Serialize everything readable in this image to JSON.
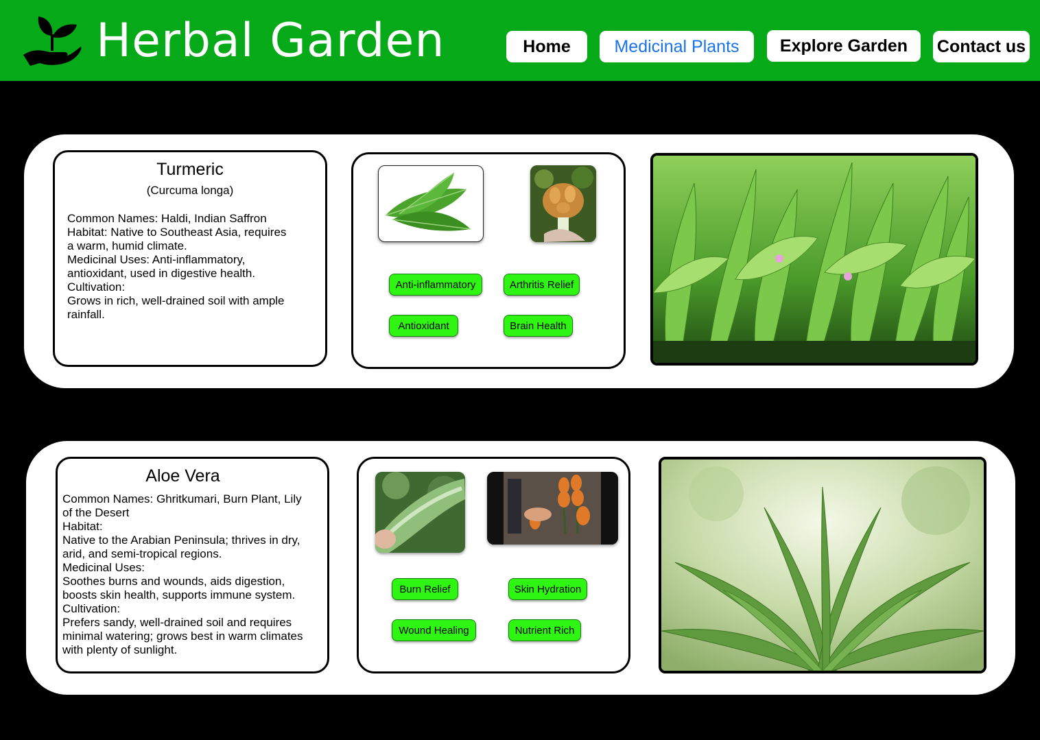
{
  "header": {
    "title": "Herbal Garden",
    "nav": {
      "home": "Home",
      "medicinal_plants": "Medicinal Plants",
      "explore_garden": "Explore Garden",
      "contact_us": "Contact us"
    },
    "logo_icon": "plant-in-hand-icon"
  },
  "colors": {
    "header_bg": "#06a918",
    "tag_bg": "#2ef612",
    "active_nav": "#1a73e8",
    "page_bg": "#000000"
  },
  "plants": [
    {
      "name": "Turmeric",
      "scientific_name": "(Curcuma longa)",
      "description": "Common Names:  Haldi, Indian Saffron\nHabitat: Native to Southeast Asia, requires\na warm, humid climate.\nMedicinal Uses: Anti-inflammatory,\nantioxidant, used in digestive health.\nCultivation:\nGrows in rich, well-drained soil with ample\nrainfall.",
      "tags": [
        "Anti-inflammatory",
        "Arthritis Relief",
        "Antioxidant",
        "Brain Health"
      ]
    },
    {
      "name": "Aloe Vera",
      "description": "Common Names: Ghritkumari, Burn Plant, Lily\nof the Desert\nHabitat:\n Native to the Arabian Peninsula; thrives in dry,\narid, and semi-tropical regions.\nMedicinal Uses:\n Soothes burns and wounds, aids digestion,\nboosts skin health, supports immune system.\nCultivation:\n Prefers sandy, well-drained soil and requires\nminimal watering; grows best in warm climates\nwith plenty of sunlight.",
      "tags": [
        "Burn Relief",
        "Skin Hydration",
        "Wound Healing",
        "Nutrient Rich"
      ]
    }
  ]
}
